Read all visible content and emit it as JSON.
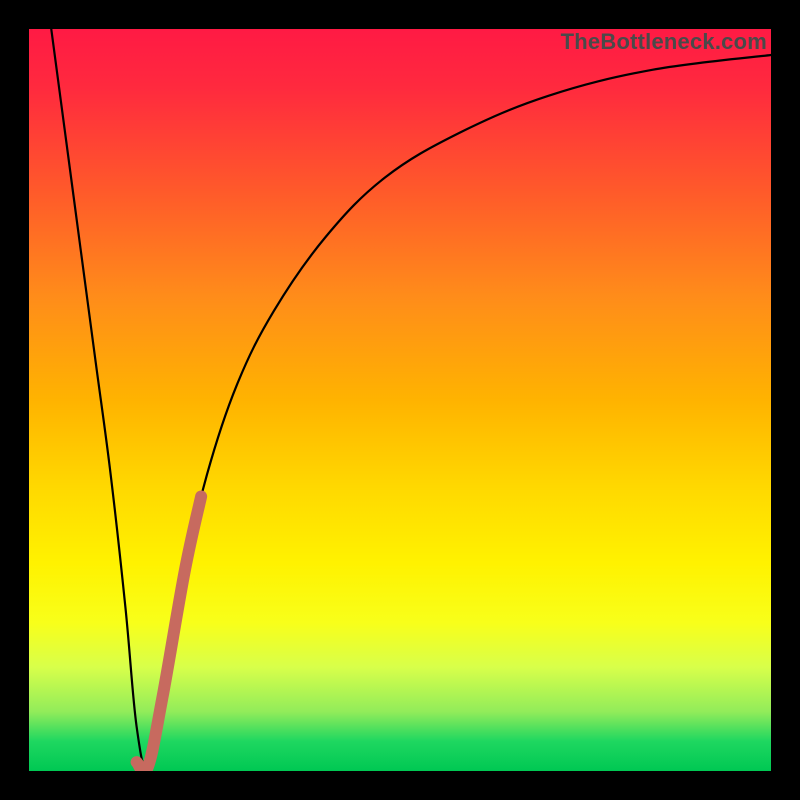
{
  "watermark": "TheBottleneck.com",
  "colors": {
    "curve_stroke": "#000000",
    "highlight_stroke": "#c76a5f",
    "frame": "#000000"
  },
  "chart_data": {
    "type": "line",
    "title": "",
    "xlabel": "",
    "ylabel": "",
    "xlim": [
      0,
      100
    ],
    "ylim": [
      0,
      100
    ],
    "grid": false,
    "series": [
      {
        "name": "bottleneck-curve",
        "x": [
          3,
          5,
          7,
          9,
          11,
          13,
          14.5,
          16,
          18,
          21,
          24,
          28,
          33,
          40,
          48,
          58,
          70,
          84,
          100
        ],
        "y": [
          100,
          85,
          70,
          55,
          40,
          22,
          6,
          0.5,
          10,
          27,
          40,
          52,
          62,
          72,
          80,
          86,
          91,
          94.5,
          96.5
        ]
      },
      {
        "name": "highlight-segment",
        "x": [
          14.5,
          16,
          18,
          21,
          23.2
        ],
        "y": [
          1.2,
          0.5,
          10,
          27,
          37
        ]
      }
    ]
  }
}
